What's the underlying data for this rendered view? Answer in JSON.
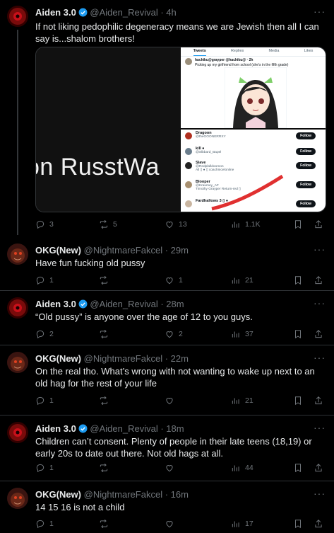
{
  "tweets": [
    {
      "name": "Aiden 3.0",
      "handle": "@Aiden_Revival",
      "time": "· 4h",
      "text": "If not liking pedophilic degeneracy means we are Jewish then all I can say is...shalom brothers!",
      "replies": "3",
      "reposts": "5",
      "likes": "13",
      "views": "1.1K",
      "media": {
        "overlay_text": "on RusstWa",
        "shot1": {
          "tabs": [
            "Tweets",
            "Replies",
            "Media",
            "Likes"
          ],
          "author": "hachiku@grayper @hachiku@ · 2h",
          "text": "Picking up my girlfriend from school (she's in the fifth grade)"
        },
        "shot2": {
          "follow_label": "Follow",
          "rows": [
            {
              "name": "Dragoon",
              "sub": "@theGOONERRXY"
            },
            {
              "name": "kill ●",
              "sub": "@Slbbard_Bapel"
            },
            {
              "name": "Slave",
              "sub": "@Redplalldoomon\nAll ▯ ● ▯ coachnicelonline"
            },
            {
              "name": "Blooper",
              "sub": "@Kraumey_AF\nTimothy Grayper Return-red ▯"
            },
            {
              "name": "Fardhallows 3 ▯ ●",
              "sub": ""
            }
          ]
        }
      }
    },
    {
      "name": "OKG(New)",
      "handle": "@NightmareFakcel",
      "time": "· 29m",
      "text": "Have fun fucking old pussy",
      "replies": "1",
      "reposts": "",
      "likes": "1",
      "views": "21"
    },
    {
      "name": "Aiden 3.0",
      "handle": "@Aiden_Revival",
      "time": "· 28m",
      "text": "“Old pussy” is anyone over the age of 12 to you guys.",
      "replies": "2",
      "reposts": "",
      "likes": "2",
      "views": "37"
    },
    {
      "name": "OKG(New)",
      "handle": "@NightmareFakcel",
      "time": "· 22m",
      "text": "On the real tho. What’s wrong with not wanting to wake up next to an old hag for the rest of your life",
      "replies": "1",
      "reposts": "",
      "likes": "",
      "views": "21"
    },
    {
      "name": "Aiden 3.0",
      "handle": "@Aiden_Revival",
      "time": "· 18m",
      "text": "Children can’t consent. Plenty of people in their late teens (18,19) or early 20s to date out there. Not old hags at all.",
      "replies": "1",
      "reposts": "",
      "likes": "",
      "views": "44"
    },
    {
      "name": "OKG(New)",
      "handle": "@NightmareFakcel",
      "time": "· 16m",
      "text": "14 15 16 is not a child",
      "replies": "1",
      "reposts": "",
      "likes": "",
      "views": "17"
    }
  ],
  "more_label": "···",
  "colors": {
    "background": "#000000",
    "text": "#e7e9ea",
    "muted": "#71767b",
    "verified": "#1d9bf0"
  }
}
